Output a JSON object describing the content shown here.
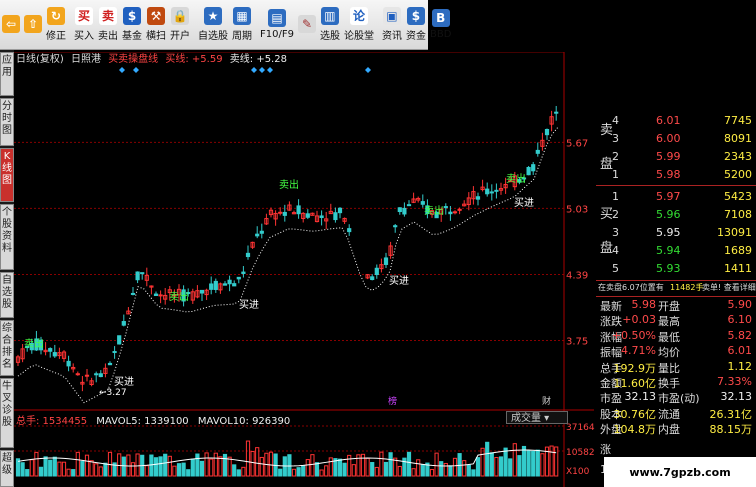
{
  "toolbar": {
    "buttons": [
      {
        "label": "",
        "icon": "back-arrow-icon"
      },
      {
        "label": "",
        "icon": "up-arrow-icon"
      },
      {
        "label": "修正",
        "icon": "refresh-icon"
      },
      {
        "label": "买入",
        "icon": "buy-icon",
        "glyph": "买"
      },
      {
        "label": "卖出",
        "icon": "sell-icon",
        "glyph": "卖"
      },
      {
        "label": "基金",
        "icon": "fund-icon"
      },
      {
        "label": "横扫",
        "icon": "hammer-icon"
      },
      {
        "label": "开户",
        "icon": "lock-icon"
      },
      {
        "label": "自选股",
        "icon": "star-icon"
      },
      {
        "label": "周期",
        "icon": "calendar-icon"
      },
      {
        "label": "F10/F9",
        "icon": "f10-icon"
      },
      {
        "label": "",
        "icon": "pen-icon"
      },
      {
        "label": "选股",
        "icon": "filter-icon"
      },
      {
        "label": "论股堂",
        "icon": "talk-icon",
        "glyph": "论"
      },
      {
        "label": "资讯",
        "icon": "news-icon"
      },
      {
        "label": "资金",
        "icon": "capital-icon"
      },
      {
        "label": "BBD",
        "icon": "bbd-icon"
      }
    ]
  },
  "side_tabs": [
    {
      "label": "应用"
    },
    {
      "label": "分时图"
    },
    {
      "label": "K线图",
      "active": true
    },
    {
      "label": "个股资料"
    },
    {
      "label": "自选股"
    },
    {
      "label": "综合排名"
    },
    {
      "label": "牛叉诊股"
    },
    {
      "label": "超级"
    }
  ],
  "chart_header": {
    "period": "日线(复权)",
    "indicator": "日照港",
    "line1": "买卖操盘线",
    "buy_line": "买线: +5.59",
    "sell_line": "卖线: +5.28"
  },
  "chart_data": {
    "type": "candlestick",
    "price_ticks": [
      "5.67",
      "5.03",
      "4.39",
      "3.75"
    ],
    "low_marker": "3.27",
    "signals": [
      {
        "label": "卖出",
        "type": "sell"
      },
      {
        "label": "买进",
        "type": "buy"
      },
      {
        "label": "卖出",
        "type": "sell"
      },
      {
        "label": "买进",
        "type": "buy"
      },
      {
        "label": "卖出",
        "type": "sell"
      },
      {
        "label": "买进",
        "type": "buy"
      },
      {
        "label": "卖出",
        "type": "sell"
      },
      {
        "label": "卖出",
        "type": "sell"
      },
      {
        "label": "买进",
        "type": "buy"
      }
    ],
    "event_markers": [
      "榜",
      "财"
    ],
    "volume_ticks": [
      "37164",
      "10582",
      "X100"
    ],
    "colors": {
      "up": "#ff3333",
      "down": "#33cccc",
      "grid": "#880000",
      "ma": "#ffffff"
    }
  },
  "volume_header": {
    "total": "总手: 1534455",
    "mavol5": "MAVOL5: 1339100",
    "mavol10": "MAVOL10: 926390",
    "selector": "成交量"
  },
  "order_book": {
    "ask_label": "卖盘",
    "bid_label": "买盘",
    "asks": [
      {
        "level": "4",
        "price": "6.01",
        "vol": "7745"
      },
      {
        "level": "3",
        "price": "6.00",
        "vol": "8091"
      },
      {
        "level": "2",
        "price": "5.99",
        "vol": "2343"
      },
      {
        "level": "1",
        "price": "5.98",
        "vol": "5200"
      }
    ],
    "bids": [
      {
        "level": "1",
        "price": "5.97",
        "vol": "5423"
      },
      {
        "level": "2",
        "price": "5.96",
        "vol": "7108"
      },
      {
        "level": "3",
        "price": "5.95",
        "vol": "13091"
      },
      {
        "level": "4",
        "price": "5.94",
        "vol": "1689"
      },
      {
        "level": "5",
        "price": "5.93",
        "vol": "1411"
      }
    ],
    "status": "在卖盘6.07位置有",
    "status2": "11482手",
    "status3": "卖单! 查看详细",
    "stats": [
      {
        "k1": "最新",
        "v1": "5.98",
        "k2": "开盘",
        "v2": "5.90"
      },
      {
        "k1": "涨跌",
        "v1": "+0.03",
        "k2": "最高",
        "v2": "6.10"
      },
      {
        "k1": "涨幅",
        "v1": "+0.50%",
        "k2": "最低",
        "v2": "5.82"
      },
      {
        "k1": "振幅",
        "v1": "4.71%",
        "k2": "均价",
        "v2": "6.01"
      },
      {
        "k1": "总手",
        "v1": "192.9万",
        "k2": "量比",
        "v2": "1.12"
      },
      {
        "k1": "金额",
        "v1": "11.60亿",
        "k2": "换手",
        "v2": "7.33%"
      },
      {
        "k1": "市盈",
        "v1": "32.13",
        "k2": "市盈(动)",
        "v2": "32.13"
      },
      {
        "k1": "股本",
        "v1": "30.76亿",
        "k2": "流通",
        "v2": "26.31亿"
      },
      {
        "k1": "外盘",
        "v1": "104.8万",
        "k2": "内盘",
        "v2": "88.15万"
      }
    ],
    "trailing_labels": [
      "涨",
      "14"
    ]
  },
  "watermark": "www.7gpzb.com"
}
